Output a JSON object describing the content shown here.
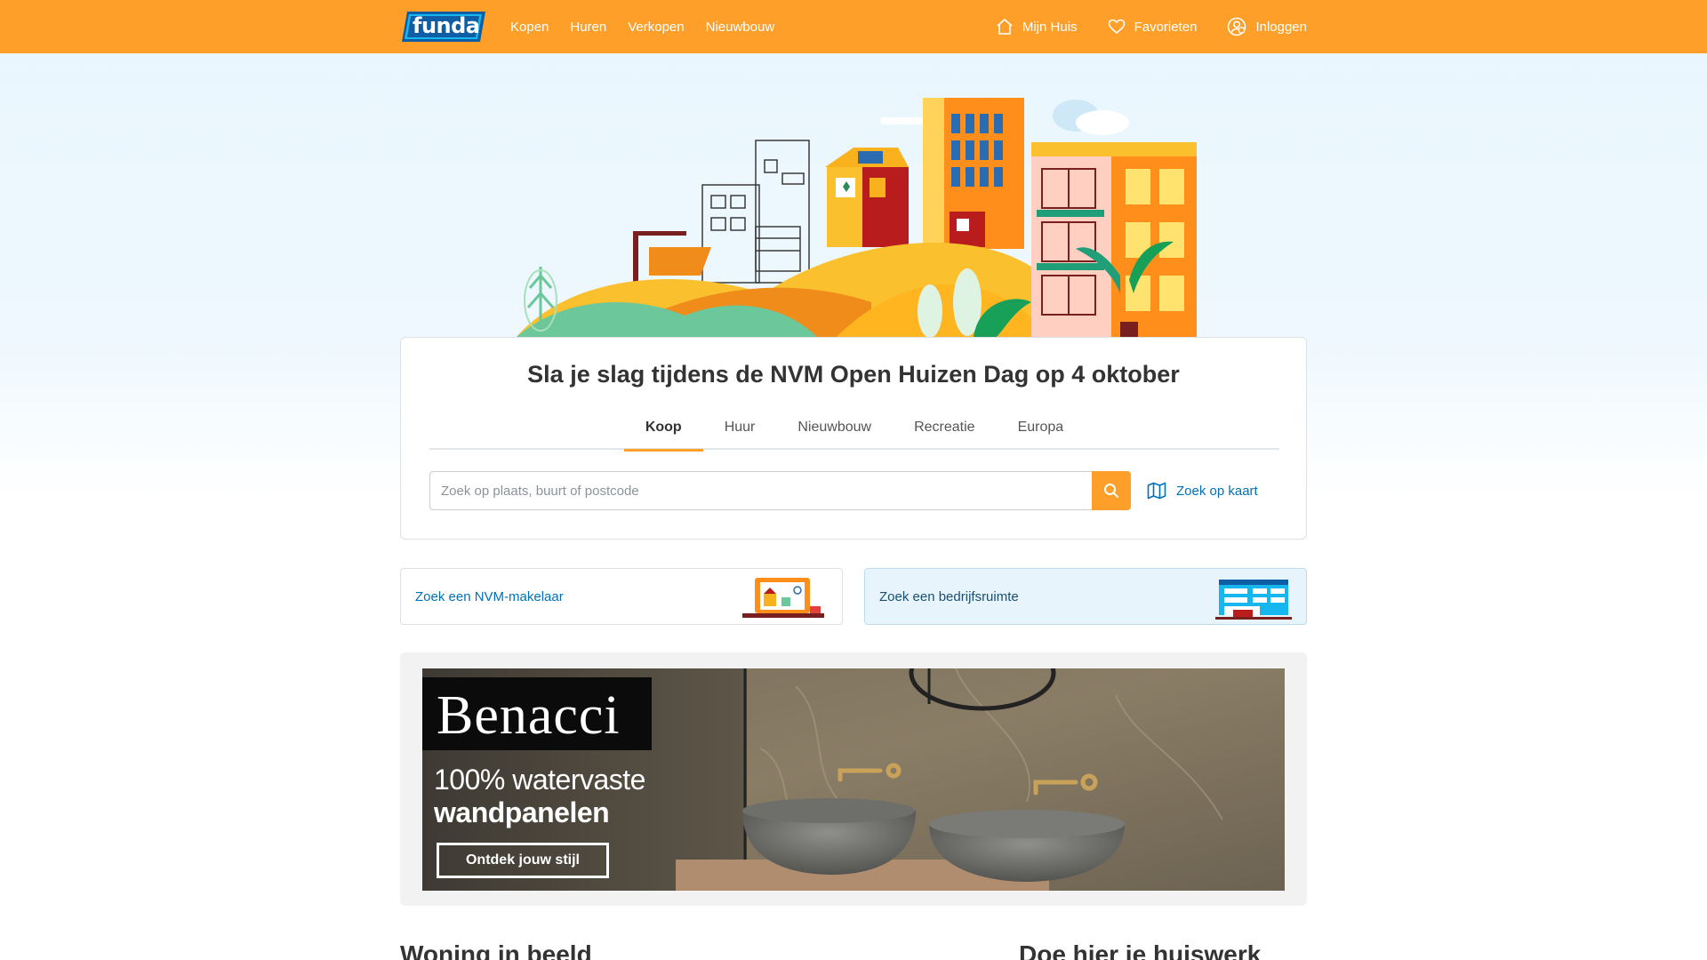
{
  "header": {
    "logo_text": "funda",
    "nav": [
      "Kopen",
      "Huren",
      "Verkopen",
      "Nieuwbouw"
    ],
    "right": {
      "mijn_huis": "Mijn Huis",
      "favorieten": "Favorieten",
      "inloggen": "Inloggen"
    }
  },
  "search_card": {
    "headline": "Sla je slag tijdens de NVM Open Huizen Dag op 4 oktober",
    "tabs": [
      "Koop",
      "Huur",
      "Nieuwbouw",
      "Recreatie",
      "Europa"
    ],
    "active_tab": "Koop",
    "search_placeholder": "Zoek op plaats, buurt of postcode",
    "search_value": "",
    "map_link": "Zoek op kaart"
  },
  "tiles": {
    "makelaar": "Zoek een NVM-makelaar",
    "bedrijfsruimte": "Zoek een bedrijfsruimte"
  },
  "ad": {
    "brand": "Benacci",
    "line1": "100% watervaste",
    "line2": "wandpanelen",
    "cta": "Ontdek jouw stijl"
  },
  "sections": {
    "left_heading": "Woning in beeld",
    "right_heading": "Doe hier je huiswerk"
  },
  "colors": {
    "brand_orange": "#fe9f2a",
    "link_blue": "#0071b3",
    "text_dark": "#333333"
  },
  "icons": {
    "search": "search-icon",
    "map": "map-icon",
    "home": "home-icon",
    "heart": "heart-icon",
    "user": "user-icon"
  }
}
